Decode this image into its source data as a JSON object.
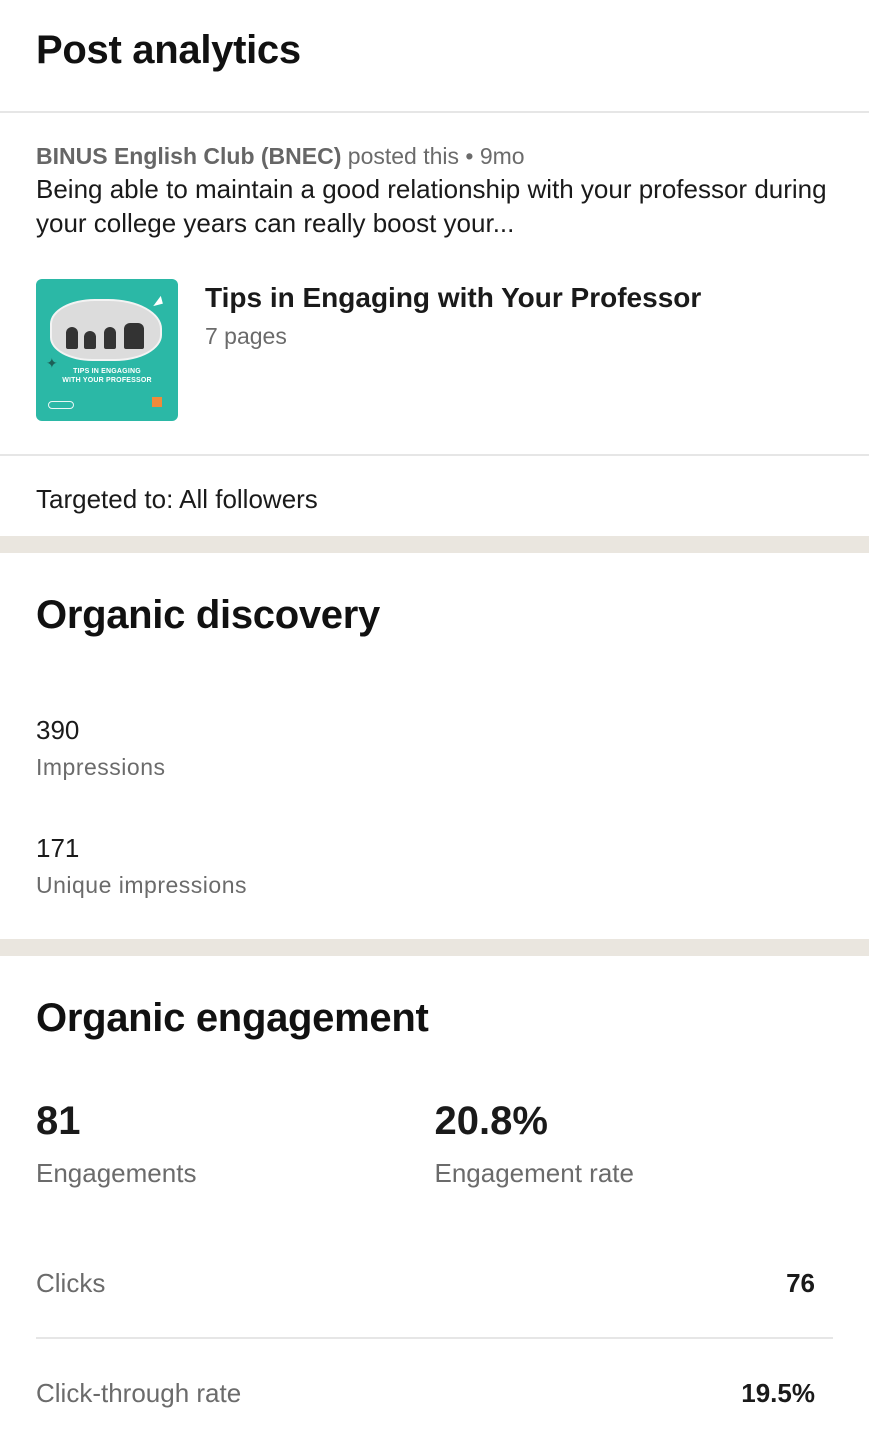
{
  "header": {
    "title": "Post analytics"
  },
  "post": {
    "author": "BINUS English Club (BNEC)",
    "action": " posted this • 9mo",
    "text": "Being able to maintain a good relationship with your professor during your college years can really boost your...",
    "document": {
      "title": "Tips in Engaging with Your Professor",
      "pages": "7 pages",
      "thumbnail_caption_line1": "TIPS IN ENGAGING",
      "thumbnail_caption_line2": "WITH YOUR PROFESSOR",
      "thumbnail_color": "#2bb8a6"
    }
  },
  "targeting": {
    "text": "Targeted to: All followers"
  },
  "discovery": {
    "title": "Organic discovery",
    "impressions": {
      "value": "390",
      "label": "Impressions"
    },
    "unique_impressions": {
      "value": "171",
      "label": "Unique impressions"
    }
  },
  "engagement": {
    "title": "Organic engagement",
    "engagements": {
      "value": "81",
      "label": "Engagements"
    },
    "engagement_rate": {
      "value": "20.8%",
      "label": "Engagement rate"
    },
    "rows": [
      {
        "label": "Clicks",
        "value": "76"
      },
      {
        "label": "Click-through rate",
        "value": "19.5%"
      }
    ]
  },
  "colors": {
    "divider": "#eae6df",
    "muted_text": "#6b6b6b"
  }
}
